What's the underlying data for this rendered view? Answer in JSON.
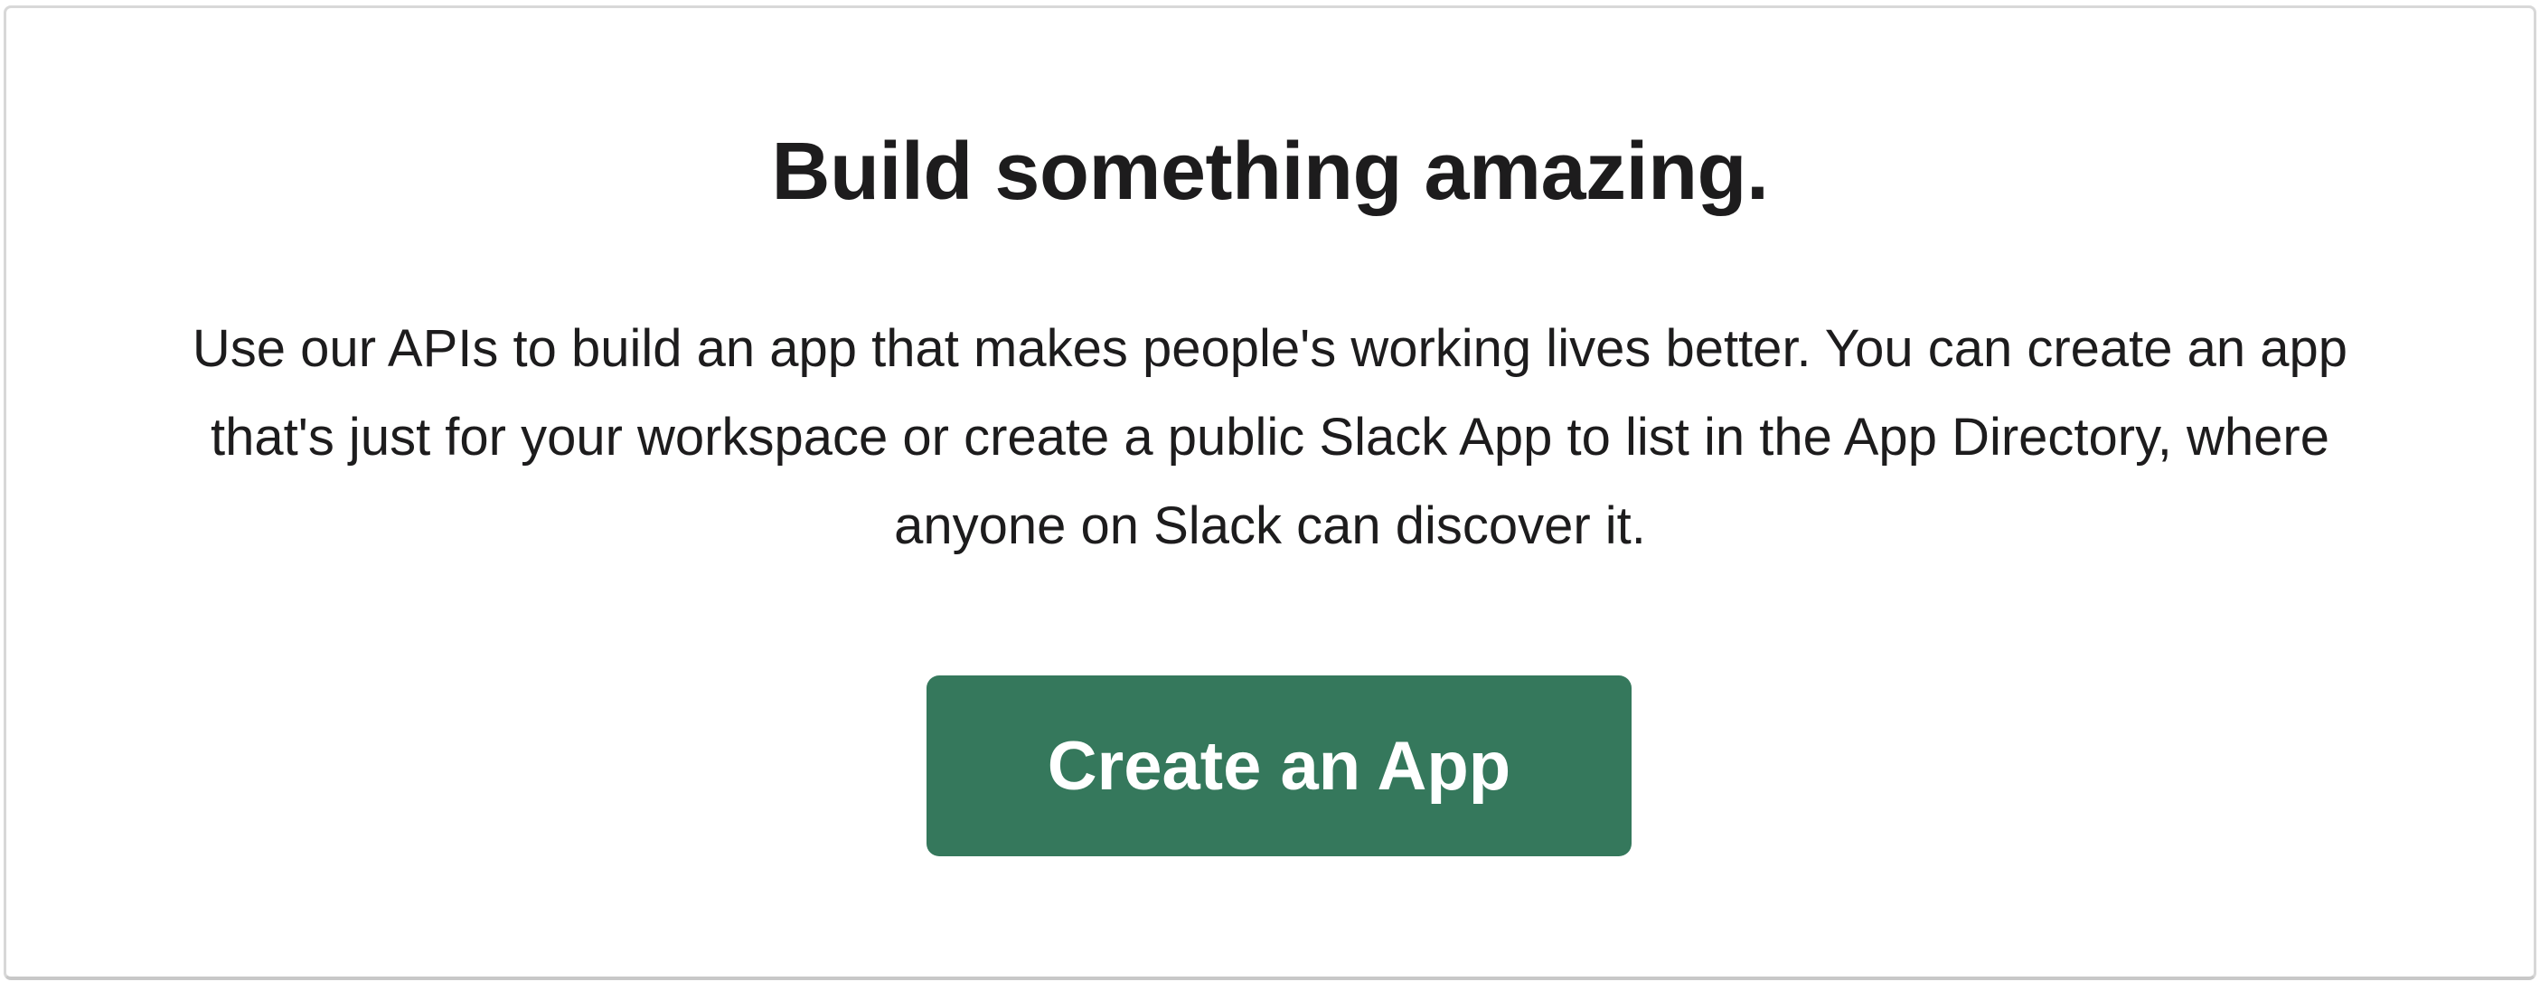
{
  "hero": {
    "title": "Build something amazing.",
    "description": "Use our APIs to build an app that makes people's working lives better. You can create an app that's just for your workspace or create a public Slack App to list in the App Directory, where anyone on Slack can discover it.",
    "cta_label": "Create an App"
  },
  "colors": {
    "button_bg": "#35785c",
    "button_text": "#ffffff",
    "text": "#1d1c1d",
    "border": "#d8d8d8"
  }
}
